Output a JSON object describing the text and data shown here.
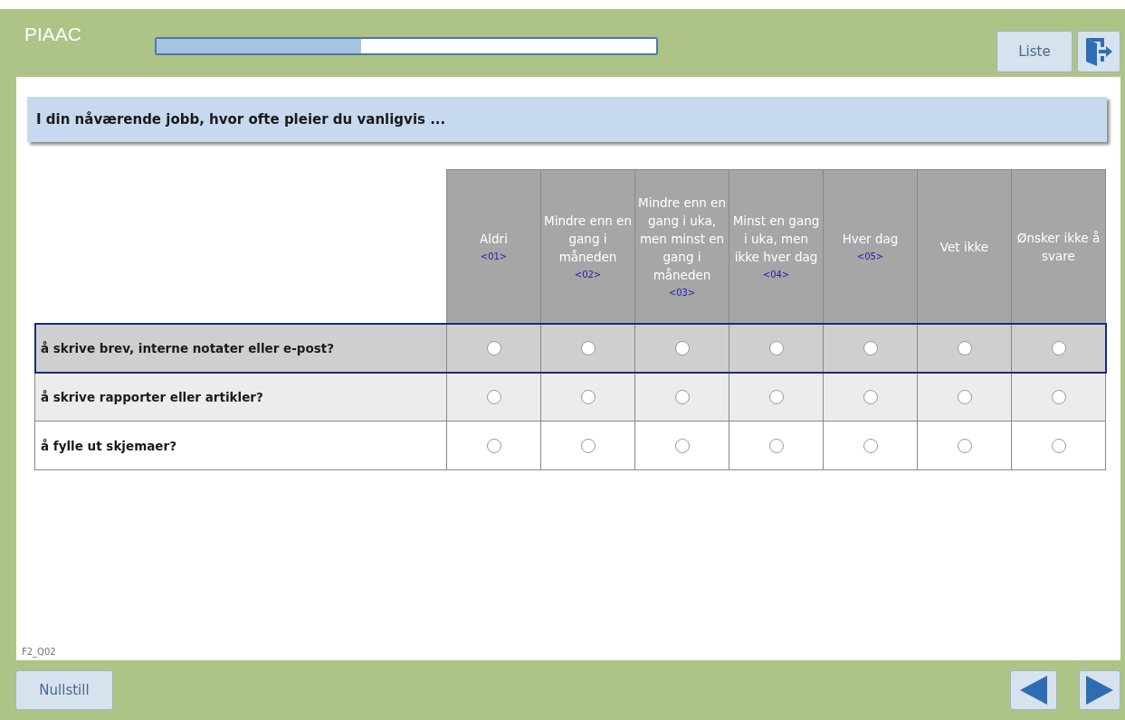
{
  "header": {
    "title": "PIAAC",
    "progress": {
      "level": 0.41
    },
    "list_button": "Liste"
  },
  "question": "I din nåværende jobb, hvor ofte pleier du vanligvis ...",
  "table": {
    "columns": [
      {
        "label": "Aldri",
        "code": "<01>"
      },
      {
        "label": "Mindre enn en gang i måneden",
        "code": "<02>"
      },
      {
        "label": "Mindre enn en gang i uka, men minst en gang i måneden",
        "code": "<03>"
      },
      {
        "label": "Minst en gang i uka, men ikke hver dag",
        "code": "<04>"
      },
      {
        "label": "Hver dag",
        "code": "<05>"
      },
      {
        "label": "Vet ikke"
      },
      {
        "label": "Ønsker ikke å svare"
      }
    ],
    "rows": [
      {
        "label": "å skrive brev, interne notater eller e-post?",
        "focused": true,
        "selected": [
          false,
          false,
          false,
          false,
          false,
          false,
          false
        ]
      },
      {
        "label": "å skrive rapporter eller artikler?",
        "focused": false,
        "selected": [
          false,
          false,
          false,
          false,
          false,
          false,
          false
        ]
      },
      {
        "label": "å fylle ut skjemaer?",
        "focused": false,
        "selected": [
          false,
          false,
          false,
          false,
          false,
          false,
          false
        ]
      }
    ]
  },
  "item_id": "F2_Q02",
  "footer": {
    "reset_button": "Nullstill"
  }
}
